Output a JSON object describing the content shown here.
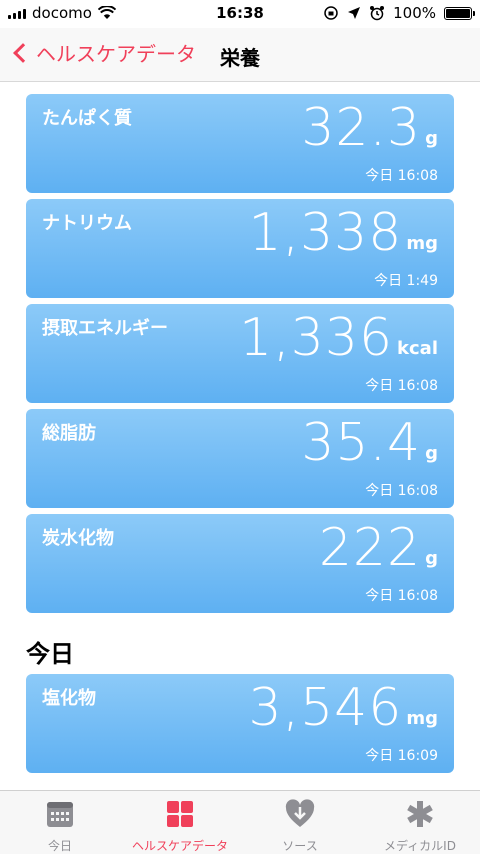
{
  "status_bar": {
    "carrier": "docomo",
    "time": "16:38",
    "battery": "100%"
  },
  "nav": {
    "back_label": "ヘルスケアデータ",
    "title": "栄養"
  },
  "cards": [
    {
      "title": "たんぱく質",
      "value": "32.3",
      "unit": "g",
      "time": "今日 16:08"
    },
    {
      "title": "ナトリウム",
      "value": "1,338",
      "unit": "mg",
      "time": "今日 1:49"
    },
    {
      "title": "摂取エネルギー",
      "value": "1,336",
      "unit": "kcal",
      "time": "今日 16:08"
    },
    {
      "title": "総脂肪",
      "value": "35.4",
      "unit": "g",
      "time": "今日 16:08"
    },
    {
      "title": "炭水化物",
      "value": "222",
      "unit": "g",
      "time": "今日 16:08"
    }
  ],
  "today_section": {
    "header": "今日",
    "cards": [
      {
        "title": "塩化物",
        "value": "3,546",
        "unit": "mg",
        "time": "今日 16:09"
      }
    ]
  },
  "tabs": [
    {
      "label": "今日",
      "icon": "calendar-icon"
    },
    {
      "label": "ヘルスケアデータ",
      "icon": "grid-icon"
    },
    {
      "label": "ソース",
      "icon": "heart-download-icon"
    },
    {
      "label": "メディカルID",
      "icon": "asterisk-icon"
    }
  ],
  "colors": {
    "accent": "#f0405a",
    "card_top": "#8ccaf8",
    "card_bottom": "#5eb0f2"
  }
}
